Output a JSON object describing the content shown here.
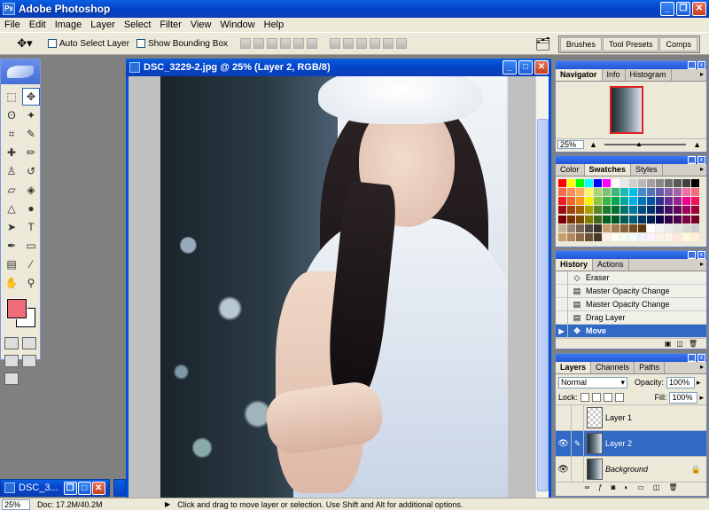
{
  "app": {
    "title": "Adobe Photoshop"
  },
  "menu": [
    "File",
    "Edit",
    "Image",
    "Layer",
    "Select",
    "Filter",
    "View",
    "Window",
    "Help"
  ],
  "options": {
    "auto_select": "Auto Select Layer",
    "bounding_box": "Show Bounding Box",
    "well_tabs": [
      "Brushes",
      "Tool Presets",
      "Comps"
    ]
  },
  "document": {
    "title": "DSC_3229-2.jpg @ 25% (Layer 2, RGB/8)"
  },
  "minimized": {
    "title": "DSC_3..."
  },
  "status": {
    "zoom": "25%",
    "doc": "Doc: 17.2M/40.2M",
    "hint": "Click and drag to move layer or selection.  Use Shift and Alt for additional options."
  },
  "navigator": {
    "tabs": [
      "Navigator",
      "Info",
      "Histogram"
    ],
    "zoom": "25%"
  },
  "color": {
    "tabs": [
      "Color",
      "Swatches",
      "Styles"
    ],
    "swatches": [
      "#ff0000",
      "#ffff00",
      "#00ff00",
      "#00ffff",
      "#0000ff",
      "#ff00ff",
      "#ffffff",
      "#e8e8e8",
      "#d0d0d0",
      "#b8b8b8",
      "#a0a0a0",
      "#888888",
      "#707070",
      "#585858",
      "#404040",
      "#000000",
      "#f26c4f",
      "#f68e55",
      "#fbaf5c",
      "#fff467",
      "#acd372",
      "#7cc576",
      "#3bb878",
      "#1abbb4",
      "#00bff3",
      "#438ccb",
      "#5574b9",
      "#605ca8",
      "#855fa8",
      "#a763a8",
      "#f06ea9",
      "#f26d7d",
      "#ed1c24",
      "#f26522",
      "#f7941d",
      "#fff200",
      "#8dc73f",
      "#39b54a",
      "#00a651",
      "#00a99d",
      "#00aeef",
      "#0072bc",
      "#0054a6",
      "#2e3192",
      "#662d91",
      "#92278f",
      "#ec008c",
      "#ed145b",
      "#9e0b0f",
      "#a0410d",
      "#a36209",
      "#aba000",
      "#598527",
      "#197b30",
      "#007236",
      "#00746b",
      "#0076a3",
      "#004b80",
      "#003471",
      "#1b1464",
      "#440e62",
      "#630460",
      "#9e005d",
      "#9e0039",
      "#790000",
      "#7b2e00",
      "#7d4900",
      "#827b00",
      "#406618",
      "#005e20",
      "#005826",
      "#005952",
      "#005b7f",
      "#003663",
      "#002157",
      "#0d004c",
      "#32004b",
      "#4b0049",
      "#7b0046",
      "#7a0026",
      "#c7b299",
      "#998675",
      "#736357",
      "#534741",
      "#37302d",
      "#c69c6d",
      "#a67c52",
      "#8c6239",
      "#754c24",
      "#603913",
      "#ffffff",
      "#f5f5f5",
      "#ebebeb",
      "#e1e1e1",
      "#d7d7d7",
      "#cdcdcd",
      "#c8a070",
      "#b0885c",
      "#8a6a48",
      "#6a5038",
      "#4a3828",
      "#fff0f0",
      "#fffff0",
      "#f0fff0",
      "#f0ffff",
      "#f0f0ff",
      "#fff0ff",
      "#faf0e6",
      "#fdf5e6",
      "#ffe4e1",
      "#fff8dc",
      "#ffefd5"
    ]
  },
  "history": {
    "tabs": [
      "History",
      "Actions"
    ],
    "items": [
      {
        "label": "Eraser",
        "icon": "eraser-icon"
      },
      {
        "label": "Master Opacity Change",
        "icon": "layer-icon"
      },
      {
        "label": "Master Opacity Change",
        "icon": "layer-icon"
      },
      {
        "label": "Drag Layer",
        "icon": "layer-icon"
      },
      {
        "label": "Move",
        "icon": "move-icon"
      }
    ]
  },
  "layers": {
    "tabs": [
      "Layers",
      "Channels",
      "Paths"
    ],
    "blend": "Normal",
    "opacity_label": "Opacity:",
    "opacity": "100%",
    "lock_label": "Lock:",
    "fill_label": "Fill:",
    "fill": "100%",
    "items": [
      {
        "name": "Layer 1"
      },
      {
        "name": "Layer 2"
      },
      {
        "name": "Background"
      }
    ]
  },
  "colors": {
    "foreground": "#f06c7a",
    "background": "#ffffff",
    "selection": "#316ac5"
  }
}
